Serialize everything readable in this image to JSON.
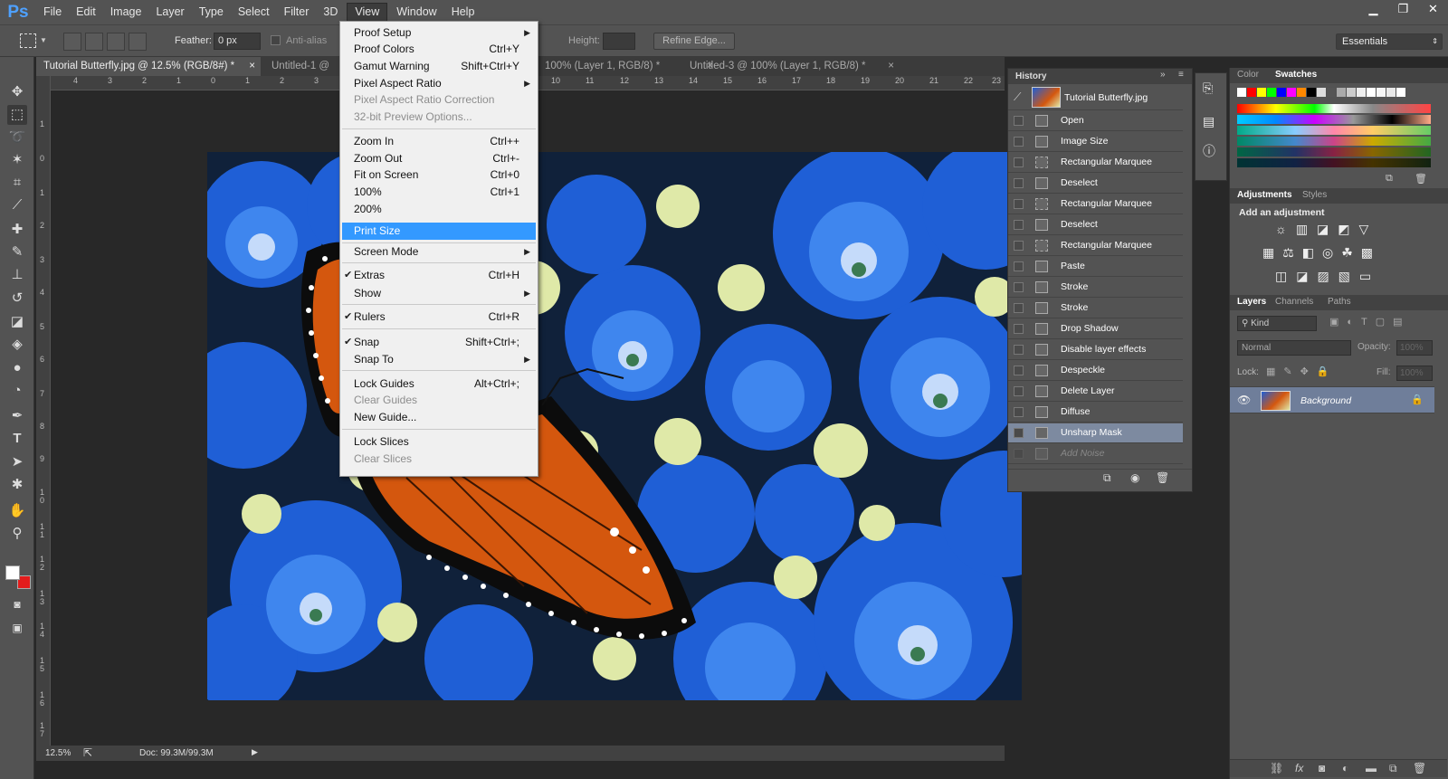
{
  "menubar": {
    "logo": "Ps",
    "items": [
      "File",
      "Edit",
      "Image",
      "Layer",
      "Type",
      "Select",
      "Filter",
      "3D",
      "View",
      "Window",
      "Help"
    ]
  },
  "options": {
    "feather_label": "Feather:",
    "feather_value": "0 px",
    "antialias_label": "Anti-alias",
    "height_label": "Height:",
    "refine_edge": "Refine Edge...",
    "workspace": "Essentials"
  },
  "tabs": [
    "Tutorial Butterfly.jpg @ 12.5% (RGB/8#) *",
    "Untitled-1 @",
    "100% (Layer 1, RGB/8) *",
    "Untitled-3 @ 100% (Layer 1, RGB/8) *"
  ],
  "ruler_h": [
    "4",
    "3",
    "2",
    "1",
    "0",
    "1",
    "2",
    "3",
    "10",
    "11",
    "12",
    "13",
    "14",
    "15",
    "16",
    "17",
    "18",
    "19",
    "20",
    "21",
    "22",
    "23"
  ],
  "ruler_v": [
    "1",
    "0",
    "1",
    "2",
    "3",
    "4",
    "5",
    "6",
    "7",
    "8",
    "9",
    "1\n0",
    "1\n1",
    "1\n2",
    "1\n3",
    "1\n4",
    "1\n5",
    "1\n6",
    "1\n7"
  ],
  "view_menu": {
    "items": [
      {
        "label": "Proof Setup",
        "arrow": true
      },
      {
        "label": "Proof Colors",
        "shortcut": "Ctrl+Y"
      },
      {
        "label": "Gamut Warning",
        "shortcut": "Shift+Ctrl+Y"
      },
      {
        "label": "Pixel Aspect Ratio",
        "arrow": true
      },
      {
        "label": "Pixel Aspect Ratio Correction",
        "disabled": true
      },
      {
        "label": "32-bit Preview Options...",
        "disabled": true
      },
      {
        "label": "Zoom In",
        "shortcut": "Ctrl++"
      },
      {
        "label": "Zoom Out",
        "shortcut": "Ctrl+-"
      },
      {
        "label": "Fit on Screen",
        "shortcut": "Ctrl+0"
      },
      {
        "label": "100%",
        "shortcut": "Ctrl+1"
      },
      {
        "label": "200%"
      },
      {
        "label": "Print Size",
        "highlighted": true
      },
      {
        "label": "Screen Mode",
        "arrow": true
      },
      {
        "label": "Extras",
        "shortcut": "Ctrl+H",
        "checked": true
      },
      {
        "label": "Show",
        "arrow": true
      },
      {
        "label": "Rulers",
        "shortcut": "Ctrl+R",
        "checked": true
      },
      {
        "label": "Snap",
        "shortcut": "Shift+Ctrl+;",
        "checked": true
      },
      {
        "label": "Snap To",
        "arrow": true
      },
      {
        "label": "Lock Guides",
        "shortcut": "Alt+Ctrl+;"
      },
      {
        "label": "Clear Guides",
        "disabled": true
      },
      {
        "label": "New Guide..."
      },
      {
        "label": "Lock Slices"
      },
      {
        "label": "Clear Slices",
        "disabled": true
      }
    ]
  },
  "history": {
    "title": "History",
    "snapshot": "Tutorial Butterfly.jpg",
    "steps": [
      "Open",
      "Image Size",
      "Rectangular Marquee",
      "Deselect",
      "Rectangular Marquee",
      "Deselect",
      "Rectangular Marquee",
      "Paste",
      "Stroke",
      "Stroke",
      "Drop Shadow",
      "Disable layer effects",
      "Despeckle",
      "Delete Layer",
      "Diffuse",
      "Unsharp Mask",
      "Add Noise"
    ]
  },
  "color_panel": {
    "tabs": [
      "Color",
      "Swatches"
    ]
  },
  "adjustments": {
    "tabs": [
      "Adjustments",
      "Styles"
    ],
    "title": "Add an adjustment"
  },
  "layers": {
    "tabs": [
      "Layers",
      "Channels",
      "Paths"
    ],
    "filter": "Kind",
    "blend": "Normal",
    "opacity_label": "Opacity:",
    "opacity": "100%",
    "lock_label": "Lock:",
    "fill_label": "Fill:",
    "fill": "100%",
    "layer_name": "Background"
  },
  "status": {
    "zoom": "12.5%",
    "doc": "Doc: 99.3M/99.3M"
  }
}
